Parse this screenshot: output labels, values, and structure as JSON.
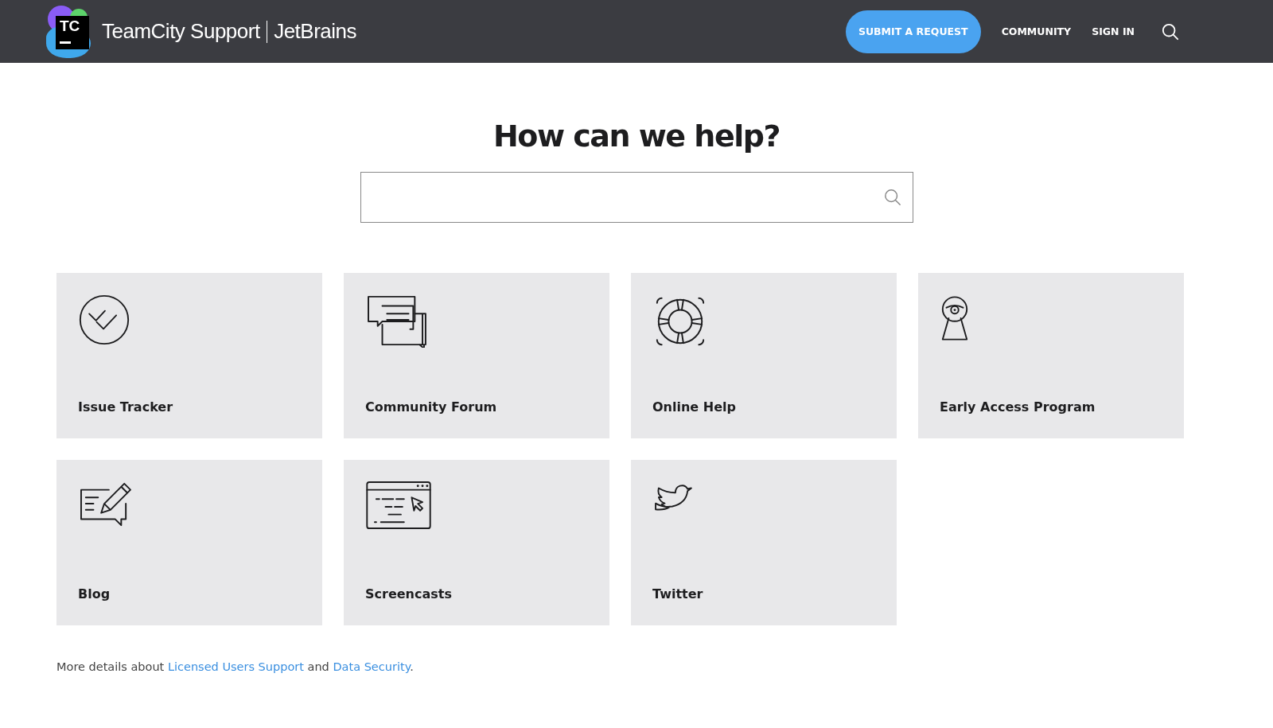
{
  "header": {
    "logo_badge": "TC",
    "brand": "TeamCity Support",
    "company": "JetBrains",
    "nav": [
      {
        "kind": "button",
        "label": "SUBMIT A REQUEST"
      },
      {
        "kind": "link",
        "label": "COMMUNITY"
      },
      {
        "kind": "link",
        "label": "SIGN IN"
      }
    ]
  },
  "hero": {
    "title": "How can we help?"
  },
  "cards": [
    {
      "label": "Issue Tracker"
    },
    {
      "label": "Community Forum"
    },
    {
      "label": "Online Help"
    },
    {
      "label": "Early Access Program"
    },
    {
      "label": "Blog"
    },
    {
      "label": "Screencasts"
    },
    {
      "label": "Twitter"
    }
  ],
  "footer": {
    "parts": [
      {
        "kind": "text",
        "text": "More details about "
      },
      {
        "kind": "link",
        "text": "Licensed Users Support"
      },
      {
        "kind": "text",
        "text": " and "
      },
      {
        "kind": "link",
        "text": "Data Security"
      },
      {
        "kind": "text",
        "text": "."
      }
    ]
  }
}
